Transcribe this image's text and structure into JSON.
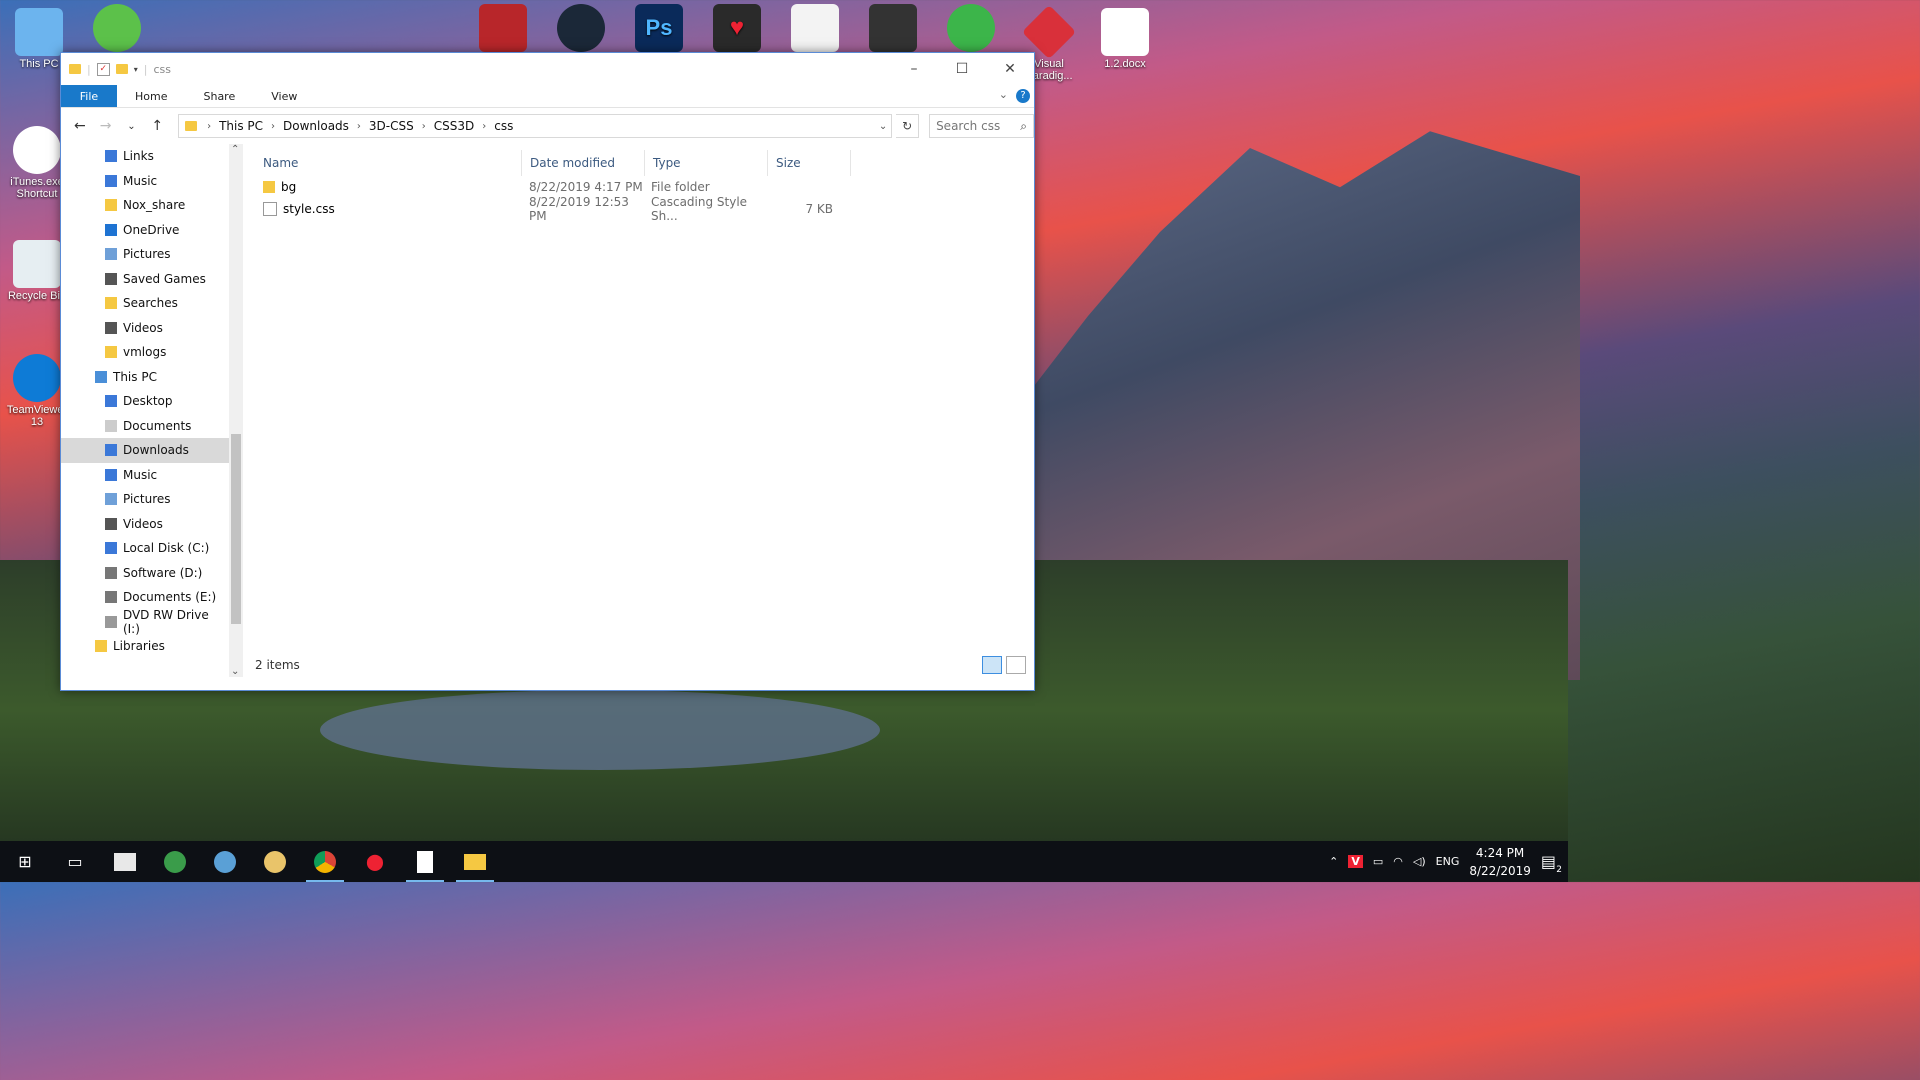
{
  "desktop": {
    "icons": [
      {
        "label": "This PC"
      },
      {
        "label": "iTunes.exe Shortcut"
      },
      {
        "label": "Recycle Bin"
      },
      {
        "label": "TeamViewer 13"
      },
      {
        "label": "Visual Paradig..."
      },
      {
        "label": "1.2.docx"
      }
    ]
  },
  "window": {
    "title": "css",
    "ribbon_tabs": [
      "File",
      "Home",
      "Share",
      "View"
    ],
    "help": "?",
    "address": {
      "crumbs": [
        "This PC",
        "Downloads",
        "3D-CSS",
        "CSS3D",
        "css"
      ]
    },
    "search_placeholder": "Search css",
    "nav_items": [
      {
        "label": "Links",
        "icon": "links-icon",
        "color": "#3b78d8"
      },
      {
        "label": "Music",
        "icon": "music-folder-icon",
        "color": "#3b78d8"
      },
      {
        "label": "Nox_share",
        "icon": "folder-icon",
        "color": "#f5c842"
      },
      {
        "label": "OneDrive",
        "icon": "onedrive-icon",
        "color": "#1e73d2"
      },
      {
        "label": "Pictures",
        "icon": "pictures-folder-icon",
        "color": "#6fa0d8"
      },
      {
        "label": "Saved Games",
        "icon": "saved-games-icon",
        "color": "#555"
      },
      {
        "label": "Searches",
        "icon": "searches-icon",
        "color": "#f5c842"
      },
      {
        "label": "Videos",
        "icon": "videos-folder-icon",
        "color": "#555"
      },
      {
        "label": "vmlogs",
        "icon": "folder-icon",
        "color": "#f5c842"
      },
      {
        "label": "This PC",
        "icon": "this-pc-icon",
        "color": "#4a8fd8"
      },
      {
        "label": "Desktop",
        "icon": "desktop-folder-icon",
        "color": "#3b78d8"
      },
      {
        "label": "Documents",
        "icon": "documents-folder-icon",
        "color": "#ccc"
      },
      {
        "label": "Downloads",
        "icon": "downloads-folder-icon",
        "color": "#3b78d8"
      },
      {
        "label": "Music",
        "icon": "music-folder-icon",
        "color": "#3b78d8"
      },
      {
        "label": "Pictures",
        "icon": "pictures-folder-icon",
        "color": "#6fa0d8"
      },
      {
        "label": "Videos",
        "icon": "videos-folder-icon",
        "color": "#555"
      },
      {
        "label": "Local Disk (C:)",
        "icon": "drive-icon",
        "color": "#3b78d8"
      },
      {
        "label": "Software (D:)",
        "icon": "drive-icon",
        "color": "#777"
      },
      {
        "label": "Documents (E:)",
        "icon": "drive-icon",
        "color": "#777"
      },
      {
        "label": "DVD RW Drive (I:)",
        "icon": "dvd-drive-icon",
        "color": "#999"
      },
      {
        "label": "Libraries",
        "icon": "libraries-icon",
        "color": "#f5c842"
      }
    ],
    "selected_nav": "Downloads",
    "columns": [
      "Name",
      "Date modified",
      "Type",
      "Size"
    ],
    "files": [
      {
        "name": "bg",
        "date": "8/22/2019 4:17 PM",
        "type": "File folder",
        "size": "",
        "icon": "folder-icon"
      },
      {
        "name": "style.css",
        "date": "8/22/2019 12:53 PM",
        "type": "Cascading Style Sh...",
        "size": "7 KB",
        "icon": "css-file-icon"
      }
    ],
    "status": "2 items"
  },
  "taskbar": {
    "apps": [
      "start-icon",
      "task-view-icon",
      "app-icon",
      "paint-icon",
      "app-icon",
      "paint-brush-icon",
      "chrome-icon",
      "app-icon",
      "notepad-icon",
      "file-explorer-icon"
    ],
    "tray": {
      "language": "ENG",
      "time": "4:24 PM",
      "date": "8/22/2019",
      "notifications": "2"
    }
  },
  "colors": {
    "accent": "#1979ca",
    "selection": "#d9d9d9",
    "folder": "#f5c842"
  }
}
